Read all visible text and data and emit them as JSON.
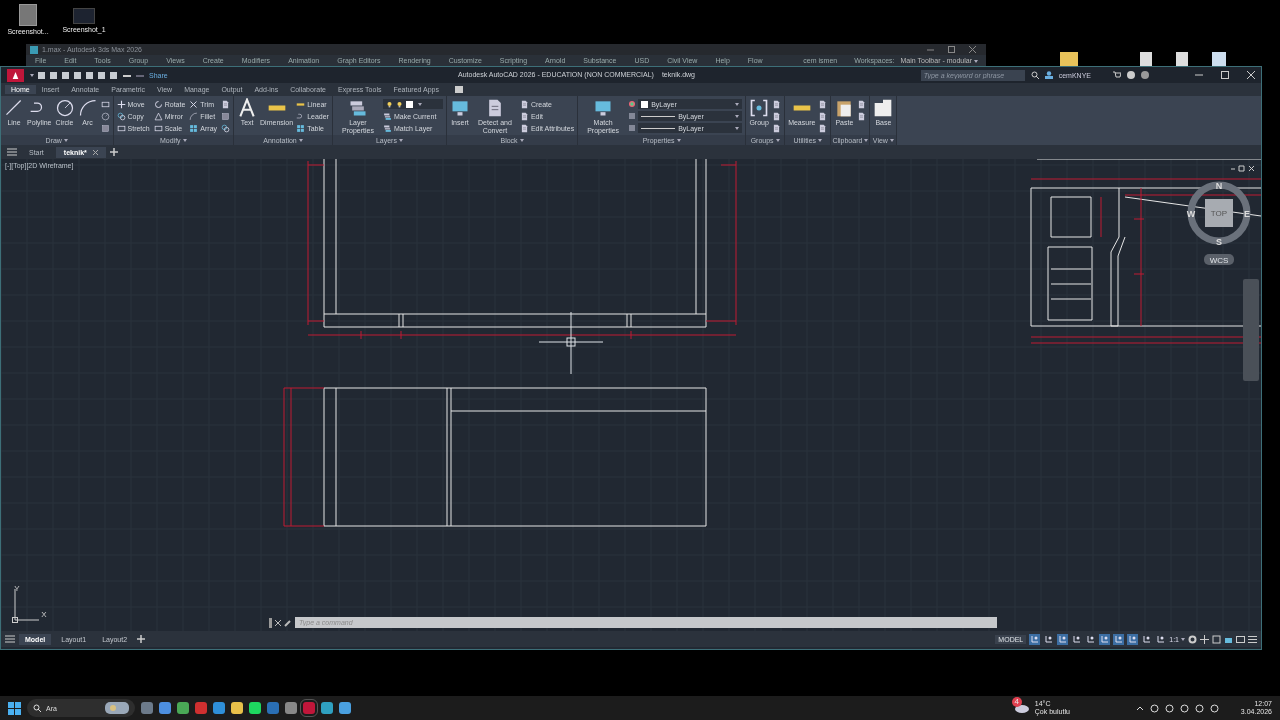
{
  "desktop_icons": [
    {
      "label": "Screenshot..."
    },
    {
      "label": "Screenshot_1"
    }
  ],
  "background_window": {
    "title": "1.max - Autodesk 3ds Max 2026",
    "menu": [
      "File",
      "Edit",
      "Tools",
      "Group",
      "Views",
      "Create",
      "Modifiers",
      "Animation",
      "Graph Editors",
      "Rendering",
      "Customize",
      "Scripting",
      "Arnold",
      "Substance",
      "USD",
      "Civil View",
      "Help",
      "Flow"
    ],
    "user": "cem ismen",
    "workspaces_label": "Workspaces:",
    "workspace": "Main Toolbar - modular"
  },
  "window": {
    "title": "Autodesk AutoCAD 2026 - EDUCATION (NON COMMERCIAL)",
    "file": "teknik.dwg",
    "share": "Share",
    "search": {
      "placeholder": "Type a keyword or phrase"
    },
    "user": "cemKNYE"
  },
  "ribbon_tabs": [
    {
      "label": "Home",
      "selected": true
    },
    {
      "label": "Insert",
      "selected": false
    },
    {
      "label": "Annotate",
      "selected": false
    },
    {
      "label": "Parametric",
      "selected": false
    },
    {
      "label": "View",
      "selected": false
    },
    {
      "label": "Manage",
      "selected": false
    },
    {
      "label": "Output",
      "selected": false
    },
    {
      "label": "Add-ins",
      "selected": false
    },
    {
      "label": "Collaborate",
      "selected": false
    },
    {
      "label": "Express Tools",
      "selected": false
    },
    {
      "label": "Featured Apps",
      "selected": false
    }
  ],
  "ribbon_panels": [
    {
      "title": "Draw",
      "tools": [
        {
          "kind": "large",
          "label": "Line"
        },
        {
          "kind": "large",
          "label": "Polyline"
        },
        {
          "kind": "large",
          "label": "Circle"
        },
        {
          "kind": "large",
          "label": "Arc"
        },
        {
          "kind": "icon"
        },
        {
          "kind": "icon"
        },
        {
          "kind": "icon"
        }
      ]
    },
    {
      "title": "Modify",
      "tools": [
        {
          "kind": "small",
          "label": "Move"
        },
        {
          "kind": "small",
          "label": "Copy"
        },
        {
          "kind": "small",
          "label": "Stretch"
        },
        {
          "kind": "small",
          "label": "Rotate"
        },
        {
          "kind": "small",
          "label": "Mirror"
        },
        {
          "kind": "small",
          "label": "Scale"
        },
        {
          "kind": "small",
          "label": "Trim"
        },
        {
          "kind": "small",
          "label": "Fillet"
        },
        {
          "kind": "small",
          "label": "Array"
        },
        {
          "kind": "icon"
        },
        {
          "kind": "icon"
        },
        {
          "kind": "icon"
        }
      ]
    },
    {
      "title": "Annotation",
      "tools": [
        {
          "kind": "large",
          "label": "Text"
        },
        {
          "kind": "large",
          "label": "Dimension"
        },
        {
          "kind": "small",
          "label": "Linear"
        },
        {
          "kind": "small",
          "label": "Leader"
        },
        {
          "kind": "small",
          "label": "Table"
        }
      ]
    },
    {
      "title": "Layers",
      "tools": [
        {
          "kind": "large",
          "label": "Layer Properties"
        },
        {
          "kind": "layer-combo"
        },
        {
          "kind": "small",
          "label": "Make Current"
        },
        {
          "kind": "small",
          "label": "Match Layer"
        }
      ]
    },
    {
      "title": "Block",
      "tools": [
        {
          "kind": "large",
          "label": "Insert"
        },
        {
          "kind": "large",
          "label": "Detect and Convert"
        },
        {
          "kind": "small",
          "label": "Create"
        },
        {
          "kind": "small",
          "label": "Edit"
        },
        {
          "kind": "small",
          "label": "Edit Attributes"
        }
      ]
    },
    {
      "title": "Properties",
      "tools": [
        {
          "kind": "large",
          "label": "Match Properties"
        },
        {
          "kind": "combo",
          "label": "ByLayer"
        },
        {
          "kind": "combo",
          "label": "ByLayer"
        },
        {
          "kind": "combo",
          "label": "ByLayer"
        }
      ]
    },
    {
      "title": "Groups",
      "tools": [
        {
          "kind": "large",
          "label": "Group"
        },
        {
          "kind": "icon"
        },
        {
          "kind": "icon"
        },
        {
          "kind": "icon"
        }
      ]
    },
    {
      "title": "Utilities",
      "tools": [
        {
          "kind": "large",
          "label": "Measure"
        },
        {
          "kind": "icon"
        },
        {
          "kind": "icon"
        },
        {
          "kind": "icon"
        }
      ]
    },
    {
      "title": "Clipboard",
      "tools": [
        {
          "kind": "large",
          "label": "Paste"
        },
        {
          "kind": "icon"
        },
        {
          "kind": "icon"
        }
      ]
    },
    {
      "title": "View",
      "tools": [
        {
          "kind": "large",
          "label": "Base"
        }
      ]
    }
  ],
  "file_tabs": [
    {
      "label": "Start",
      "selected": false
    },
    {
      "label": "teknik*",
      "selected": true
    }
  ],
  "viewport": {
    "label": "[-][Top][2D Wireframe]",
    "viewcube": {
      "north": "N",
      "west": "W",
      "east": "E",
      "south": "S",
      "top": "TOP",
      "ucs": "WCS"
    },
    "axes": {
      "y": "Y",
      "x": "X"
    }
  },
  "command_line": {
    "placeholder": "Type a command"
  },
  "layout_tabs": [
    {
      "label": "Model",
      "selected": true
    },
    {
      "label": "Layout1",
      "selected": false
    },
    {
      "label": "Layout2",
      "selected": false
    }
  ],
  "status_bar": {
    "mode": "MODEL",
    "scale": "1:1",
    "toggles": [
      {
        "on": true
      },
      {
        "on": false
      },
      {
        "on": true
      },
      {
        "on": false
      },
      {
        "on": false
      },
      {
        "on": true
      },
      {
        "on": true
      },
      {
        "on": true
      },
      {
        "on": false
      },
      {
        "on": false
      }
    ]
  },
  "taskbar": {
    "search": {
      "placeholder": "Ara"
    },
    "weather": {
      "badge": "4",
      "temperature": "14°C",
      "condition": "Çok bulutlu"
    },
    "time": "12:07",
    "date": "3.04.2026"
  }
}
